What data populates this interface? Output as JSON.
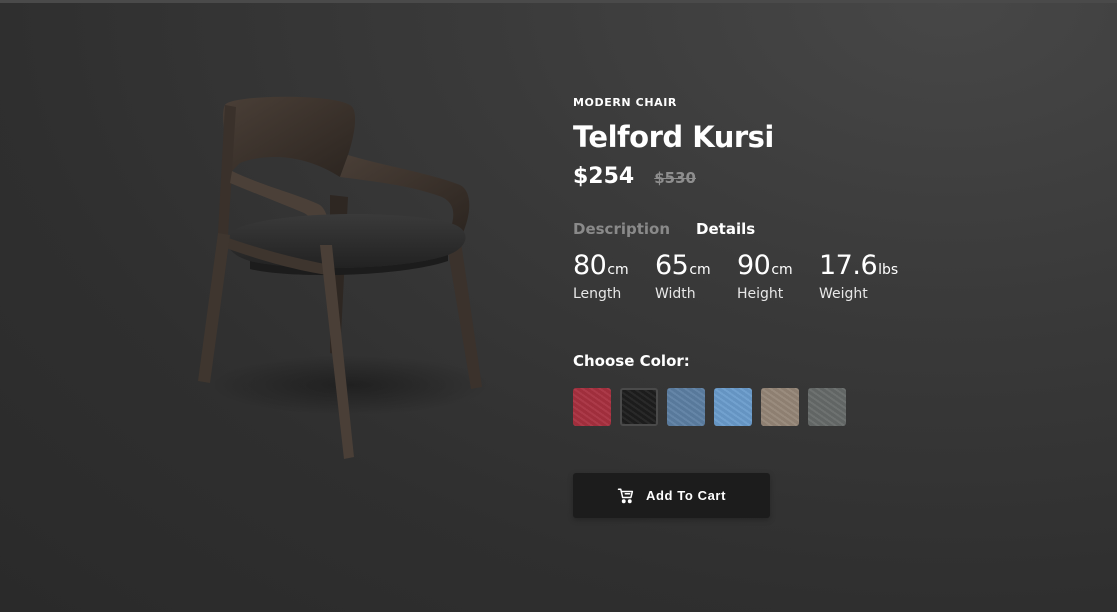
{
  "product": {
    "category": "MODERN CHAIR",
    "name": "Telford Kursi",
    "price": "$254",
    "old_price": "$530",
    "image_icon": "chair-icon"
  },
  "tabs": [
    {
      "label": "Description",
      "active": false
    },
    {
      "label": "Details",
      "active": true
    }
  ],
  "specs": [
    {
      "value": "80",
      "unit": "cm",
      "label": "Length"
    },
    {
      "value": "65",
      "unit": "cm",
      "label": "Width"
    },
    {
      "value": "90",
      "unit": "cm",
      "label": "Height"
    },
    {
      "value": "17.6",
      "unit": "lbs",
      "label": "Weight"
    }
  ],
  "color_picker": {
    "label": "Choose Color:",
    "swatches": [
      {
        "name": "red",
        "color": "#a8303f",
        "selected": false
      },
      {
        "name": "black",
        "color": "#1e1e1e",
        "selected": true
      },
      {
        "name": "denim",
        "color": "#5d7fa3",
        "selected": false
      },
      {
        "name": "sky-blue",
        "color": "#6a9ccc",
        "selected": false
      },
      {
        "name": "beige",
        "color": "#958677",
        "selected": false
      },
      {
        "name": "gray",
        "color": "#666a69",
        "selected": false
      }
    ]
  },
  "cart_button": {
    "label": "Add To Cart",
    "icon": "cart-icon"
  }
}
